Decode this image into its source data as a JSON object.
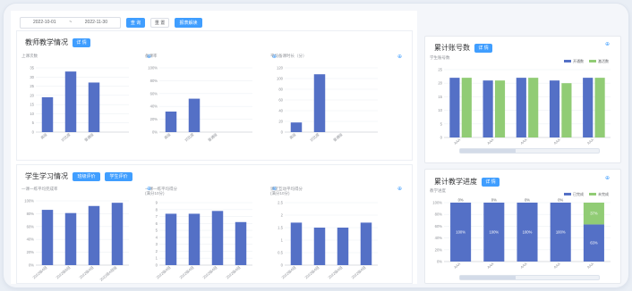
{
  "toolbar": {
    "date_start": "2022-10-01",
    "date_sep": "~",
    "date_end": "2022-11-30",
    "query_label": "查 询",
    "reset_label": "重 置",
    "report_label": "报表解读"
  },
  "teacher_section": {
    "title": "教师教学情况",
    "detail_label": "详 情"
  },
  "student_section": {
    "title": "学生学习情况",
    "btn1": "班级评价",
    "btn2": "学生评价"
  },
  "account_section": {
    "title": "累计账号数",
    "detail_label": "详 情"
  },
  "progress_section": {
    "title": "累计教学进度",
    "detail_label": "详 情"
  },
  "chart_data": [
    {
      "id": "lessons",
      "type": "bar",
      "title": "上课次数",
      "categories": [
        "高级",
        "对比度",
        "普通级",
        ""
      ],
      "values": [
        19,
        33,
        27,
        null
      ],
      "ylim": [
        0,
        35
      ],
      "ticks": [
        0,
        5,
        10,
        15,
        20,
        25,
        30,
        35
      ],
      "suffix": "",
      "color": "#5470c6"
    },
    {
      "id": "prep_rate",
      "type": "bar",
      "title": "备课率",
      "categories": [
        "高级",
        "对比度",
        "普通级",
        ""
      ],
      "values": [
        32,
        52,
        null,
        null
      ],
      "ylim": [
        0,
        100
      ],
      "ticks": [
        0,
        20,
        40,
        60,
        80,
        100
      ],
      "suffix": "%",
      "color": "#5470c6"
    },
    {
      "id": "avg_time",
      "type": "bar",
      "title": "平均备课时长（分）",
      "categories": [
        "高级",
        "对比度",
        "普通级",
        ""
      ],
      "values": [
        18,
        108,
        null,
        null
      ],
      "ylim": [
        0,
        120
      ],
      "ticks": [
        0,
        20,
        40,
        60,
        80,
        100,
        120
      ],
      "suffix": "",
      "color": "#5470c6"
    },
    {
      "id": "homework_rate",
      "type": "bar",
      "title": "一课一练平均完成率",
      "categories": [
        "2022级A班",
        "2022级B班",
        "2022级A班",
        "2022级A班级"
      ],
      "values": [
        86,
        81,
        92,
        97
      ],
      "ylim": [
        0,
        100
      ],
      "ticks": [
        0,
        20,
        40,
        60,
        80,
        100
      ],
      "suffix": "%",
      "color": "#5470c6"
    },
    {
      "id": "homework_score",
      "type": "bar",
      "title": "一课一练平均得分",
      "subtitle": "(满分10分)",
      "categories": [
        "2022级A班",
        "2022级A班",
        "2022级A班",
        "2022级A班"
      ],
      "values": [
        7.4,
        7.4,
        7.8,
        6.2
      ],
      "ylim": [
        0,
        9
      ],
      "ticks": [
        0,
        1,
        2,
        3,
        4,
        5,
        6,
        7,
        8,
        9
      ],
      "suffix": "",
      "color": "#5470c6"
    },
    {
      "id": "classroom_score",
      "type": "bar",
      "title": "课堂互动平均得分",
      "subtitle": "(满分10分)",
      "categories": [
        "2022级A班",
        "2022级A班",
        "2022级A班",
        "2022级A班"
      ],
      "values": [
        1.7,
        1.5,
        1.5,
        1.7
      ],
      "ylim": [
        0,
        2.5
      ],
      "ticks": [
        0,
        0.5,
        1,
        1.5,
        2,
        2.5
      ],
      "suffix": "",
      "color": "#5470c6"
    },
    {
      "id": "accounts",
      "type": "bar",
      "title": "学生账号数",
      "categories": [
        "AAA",
        "AAA",
        "AAA",
        "AAA",
        "AAA"
      ],
      "series": [
        {
          "name": "开通数",
          "values": [
            22,
            21,
            22,
            21,
            22
          ],
          "color": "#5470c6"
        },
        {
          "name": "激活数",
          "values": [
            22,
            21,
            22,
            20,
            22
          ],
          "color": "#91cc75"
        }
      ],
      "ylim": [
        0,
        25
      ],
      "ticks": [
        0,
        5,
        10,
        15,
        20,
        25
      ],
      "suffix": ""
    },
    {
      "id": "progress",
      "type": "bar",
      "title": "教学进度",
      "categories": [
        "AAA",
        "AAA",
        "AAA",
        "AAA",
        "AAA"
      ],
      "series": [
        {
          "name": "已完成",
          "values": [
            100,
            100,
            100,
            100,
            63
          ],
          "color": "#5470c6"
        },
        {
          "name": "未完成",
          "values": [
            0,
            0,
            0,
            0,
            37
          ],
          "color": "#91cc75"
        }
      ],
      "ylim": [
        0,
        100
      ],
      "ticks": [
        0,
        20,
        40,
        60,
        80,
        100
      ],
      "suffix": "%"
    }
  ]
}
